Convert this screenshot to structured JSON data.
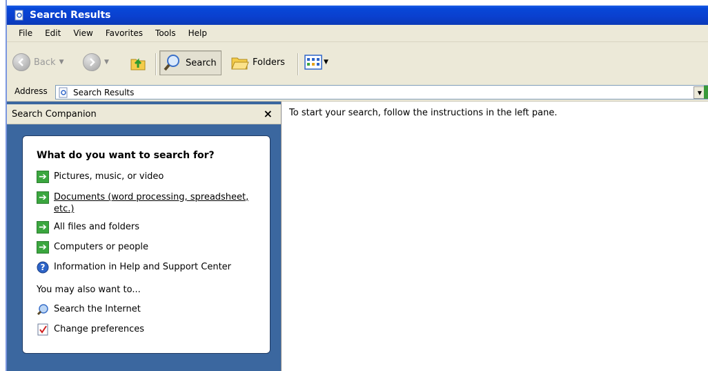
{
  "window": {
    "title": "Search Results"
  },
  "menu": [
    "File",
    "Edit",
    "View",
    "Favorites",
    "Tools",
    "Help"
  ],
  "toolbar": {
    "back_label": "Back",
    "search_label": "Search",
    "folders_label": "Folders"
  },
  "address": {
    "label": "Address",
    "value": "Search Results"
  },
  "companion": {
    "title": "Search Companion",
    "close": "×",
    "heading": "What do you want to search for?",
    "options": [
      "Pictures, music, or video",
      "Documents (word processing, spreadsheet,",
      "etc.)",
      "All files and folders",
      "Computers or people",
      "Information in Help and Support Center"
    ],
    "also_label": "You may also want to...",
    "extra": [
      "Search the Internet",
      "Change preferences"
    ]
  },
  "results": {
    "message": "To start your search, follow the instructions in the left pane."
  }
}
